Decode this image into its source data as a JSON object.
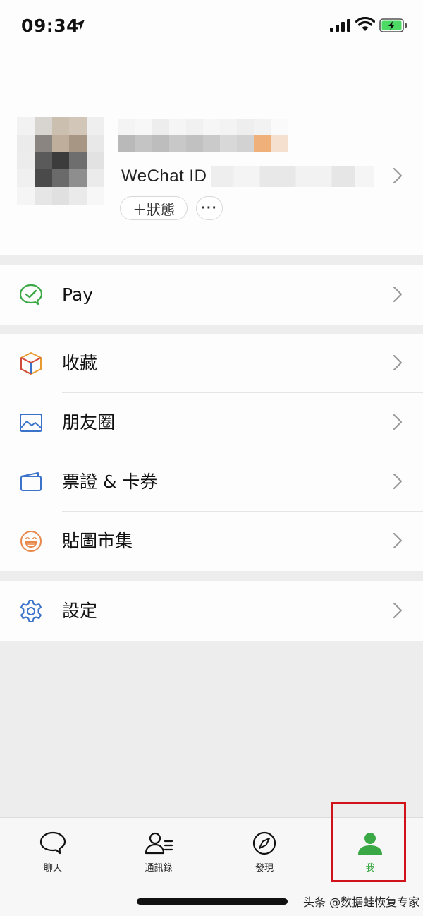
{
  "status_bar": {
    "time": "09:34"
  },
  "profile": {
    "wechat_id_label": "WeChat ID",
    "status_button_label": "＋狀態",
    "more_button_label": "···"
  },
  "menu": {
    "pay": {
      "label": "Pay",
      "icon": "pay-icon"
    },
    "favorites": {
      "label": "收藏",
      "icon": "favorites-cube-icon"
    },
    "moments": {
      "label": "朋友圈",
      "icon": "moments-image-icon"
    },
    "cards": {
      "label": "票證 & 卡券",
      "icon": "card-wallet-icon"
    },
    "stickers": {
      "label": "貼圖市集",
      "icon": "sticker-smile-icon"
    },
    "settings": {
      "label": "設定",
      "icon": "settings-gear-icon"
    }
  },
  "tabs": [
    {
      "label": "聊天",
      "icon": "chat-bubble-icon",
      "active": false
    },
    {
      "label": "通訊錄",
      "icon": "contacts-icon",
      "active": false
    },
    {
      "label": "發現",
      "icon": "compass-icon",
      "active": false
    },
    {
      "label": "我",
      "icon": "me-person-icon",
      "active": true
    }
  ],
  "colors": {
    "accent": "#3aa845",
    "highlight": "#d0121b"
  },
  "watermark": "头条 @数据蛙恢复专家"
}
